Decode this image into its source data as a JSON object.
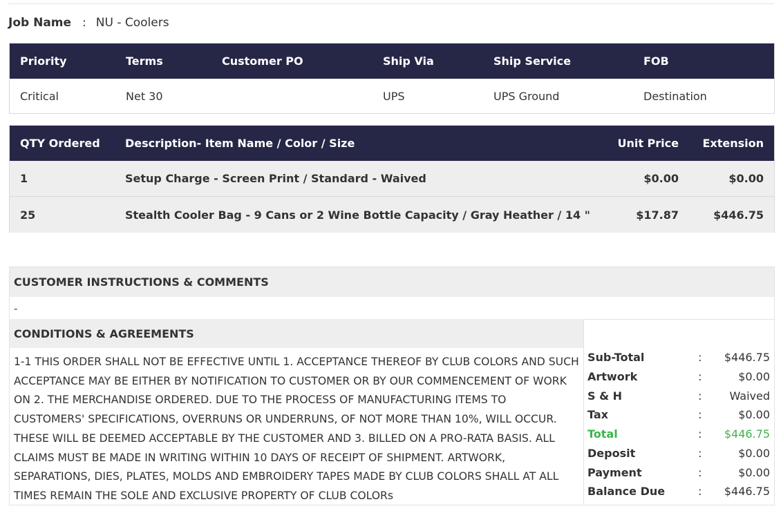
{
  "job": {
    "label": "Job Name",
    "colon": ":",
    "value": "NU - Coolers"
  },
  "order_info": {
    "headers": [
      "Priority",
      "Terms",
      "Customer PO",
      "Ship Via",
      "Ship Service",
      "FOB"
    ],
    "values": [
      "Critical",
      "Net 30",
      "",
      "UPS",
      "UPS Ground",
      "Destination"
    ]
  },
  "items": {
    "headers": [
      "QTY Ordered",
      "Description- Item Name / Color / Size",
      "Unit Price",
      "Extension"
    ],
    "rows": [
      {
        "qty": "1",
        "description": "Setup Charge - Screen Print / Standard - Waived",
        "unit_price": "$0.00",
        "extension": "$0.00"
      },
      {
        "qty": "25",
        "description": "Stealth Cooler Bag - 9 Cans or 2 Wine Bottle Capacity / Gray Heather / 14 \"",
        "unit_price": "$17.87",
        "extension": "$446.75"
      }
    ]
  },
  "instructions": {
    "title": "CUSTOMER INSTRUCTIONS & COMMENTS",
    "text": "-"
  },
  "conditions": {
    "title": "CONDITIONS & AGREEMENTS",
    "text": "1-1 THIS ORDER SHALL NOT BE EFFECTIVE UNTIL 1. ACCEPTANCE THEREOF BY CLUB COLORS AND SUCH ACCEPTANCE MAY BE EITHER BY NOTIFICATION TO CUSTOMER OR BY OUR COMMENCEMENT OF WORK ON 2. THE MERCHANDISE ORDERED. DUE TO THE PROCESS OF MANUFACTURING ITEMS TO CUSTOMERS' SPECIFICATIONS, OVERRUNS OR UNDERRUNS, OF NOT MORE THAN 10%, WILL OCCUR. THESE WILL BE DEEMED ACCEPTABLE BY THE CUSTOMER AND 3. BILLED ON A PRO-RATA BASIS. ALL CLAIMS MUST BE MADE IN WRITING WITHIN 10 DAYS OF RECEIPT OF SHIPMENT. ARTWORK, SEPARATIONS, DIES, PLATES, MOLDS AND EMBROIDERY TAPES MADE BY CLUB COLORS SHALL AT ALL TIMES REMAIN THE SOLE AND EXCLUSIVE PROPERTY OF CLUB COLORs"
  },
  "totals": {
    "colon": ":",
    "rows": [
      {
        "label": "Sub-Total",
        "value": "$446.75"
      },
      {
        "label": "Artwork",
        "value": "$0.00"
      },
      {
        "label": "S & H",
        "value": "Waived"
      },
      {
        "label": "Tax",
        "value": "$0.00"
      },
      {
        "label": "Total",
        "value": "$446.75"
      },
      {
        "label": "Deposit",
        "value": "$0.00"
      },
      {
        "label": "Payment",
        "value": "$0.00"
      },
      {
        "label": "Balance Due",
        "value": "$446.75"
      }
    ]
  },
  "colors": {
    "header_bg": "#262746",
    "row_bg": "#eeeeee",
    "total_green": "#3cb54a"
  }
}
